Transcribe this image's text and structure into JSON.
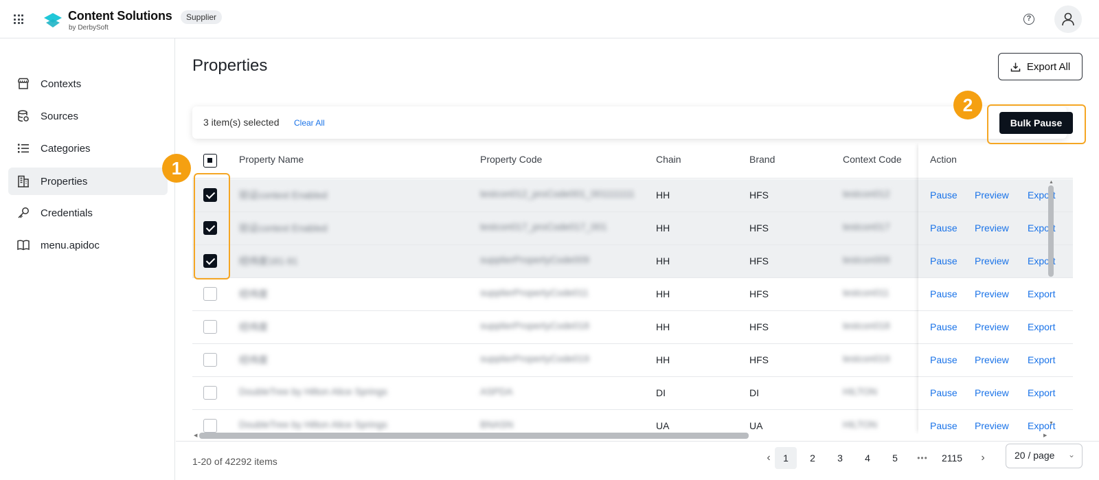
{
  "header": {
    "brand_title": "Content Solutions",
    "brand_sub": "by DerbySoft",
    "badge": "Supplier",
    "help_label": "?"
  },
  "sidebar": {
    "items": [
      {
        "label": "Contexts",
        "icon": "store-icon"
      },
      {
        "label": "Sources",
        "icon": "database-icon"
      },
      {
        "label": "Categories",
        "icon": "list-icon"
      },
      {
        "label": "Properties",
        "icon": "building-icon",
        "active": true
      },
      {
        "label": "Credentials",
        "icon": "key-icon"
      },
      {
        "label": "menu.apidoc",
        "icon": "book-icon"
      }
    ]
  },
  "main": {
    "title": "Properties",
    "export_all": "Export All"
  },
  "selection": {
    "text": "3 item(s) selected",
    "clear": "Clear All",
    "bulk_pause": "Bulk Pause"
  },
  "markers": {
    "one": "1",
    "two": "2"
  },
  "table": {
    "columns": [
      "Property Name",
      "Property Code",
      "Chain",
      "Brand",
      "Context Code",
      "Action"
    ],
    "actions": {
      "pause": "Pause",
      "preview": "Preview",
      "export": "Export"
    },
    "rows": [
      {
        "name": "验证context Enabled",
        "code": "testcon012_proCode001_001111111",
        "chain": "HH",
        "brand": "HFS",
        "context": "testcon012",
        "selected": true
      },
      {
        "name": "验证context Enabled",
        "code": "testcon017_proCode017_001",
        "chain": "HH",
        "brand": "HFS",
        "context": "testcon017",
        "selected": true
      },
      {
        "name": "经纬度181-91",
        "code": "supplierPropertyCode009",
        "chain": "HH",
        "brand": "HFS",
        "context": "testcon009",
        "selected": true
      },
      {
        "name": "经纬度",
        "code": "supplierPropertyCode011",
        "chain": "HH",
        "brand": "HFS",
        "context": "testcon011",
        "selected": false
      },
      {
        "name": "经纬度",
        "code": "supplierPropertyCode018",
        "chain": "HH",
        "brand": "HFS",
        "context": "testcon018",
        "selected": false
      },
      {
        "name": "经纬度",
        "code": "supplierPropertyCode019",
        "chain": "HH",
        "brand": "HFS",
        "context": "testcon019",
        "selected": false
      },
      {
        "name": "DoubleTree by Hilton Alice Springs",
        "code": "ASPDA",
        "chain": "DI",
        "brand": "DI",
        "context": "HILTON",
        "selected": false
      },
      {
        "name": "DoubleTree by Hilton Alice Springs",
        "code": "BNASN",
        "chain": "UA",
        "brand": "UA",
        "context": "HILTON",
        "selected": false
      }
    ]
  },
  "pagination": {
    "total": "1-20 of 42292 items",
    "pages": [
      "1",
      "2",
      "3",
      "4",
      "5"
    ],
    "ellipsis": "•••",
    "last": "2115",
    "current": "1",
    "page_size": "20 / page"
  },
  "colors": {
    "accent": "#1a73e8",
    "highlight": "#f5a623",
    "dark": "#0b121c"
  }
}
